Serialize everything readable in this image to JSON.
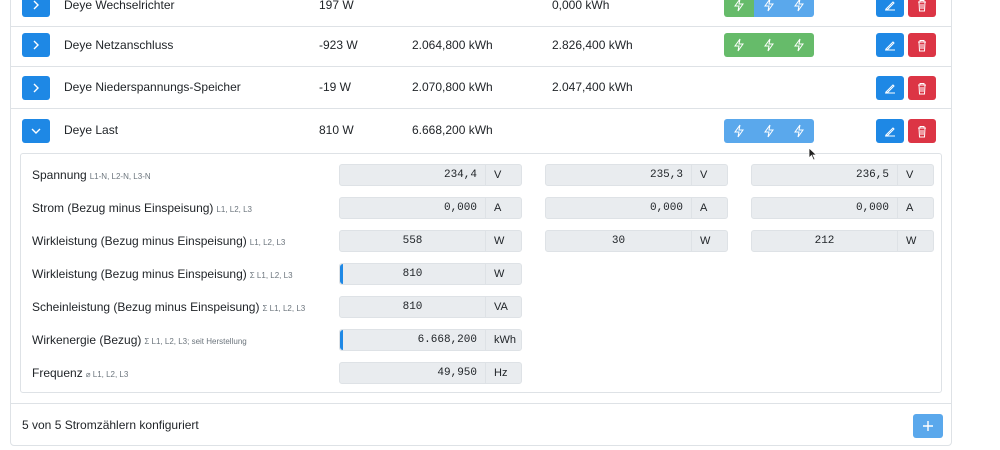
{
  "meters": [
    {
      "name": "Deye Wechselrichter",
      "power": "197 W",
      "energy_import": "",
      "energy_export": "0,000 kWh",
      "expanded": false,
      "toggle": "chevron-right"
    },
    {
      "name": "Deye Netzanschluss",
      "power": "-923 W",
      "energy_import": "2.064,800 kWh",
      "energy_export": "2.826,400 kWh",
      "expanded": false,
      "toggle": "chevron-right"
    },
    {
      "name": "Deye Niederspannungs-Speicher",
      "power": "-19 W",
      "energy_import": "2.070,800 kWh",
      "energy_export": "2.047,400 kWh",
      "expanded": false,
      "toggle": "chevron-right"
    },
    {
      "name": "Deye Last",
      "power": "810 W",
      "energy_import": "6.668,200 kWh",
      "energy_export": "",
      "expanded": true,
      "toggle": "chevron-down"
    }
  ],
  "details": {
    "spannung": {
      "label": "Spannung",
      "sub": "L1-N, L2-N, L3-N",
      "values": [
        "234,4",
        "235,3",
        "236,5"
      ],
      "unit": "V"
    },
    "strom": {
      "label": "Strom (Bezug minus Einspeisung)",
      "sub": "L1, L2, L3",
      "values": [
        "0,000",
        "0,000",
        "0,000"
      ],
      "unit": "A"
    },
    "wirkleistung": {
      "label": "Wirkleistung (Bezug minus Einspeisung)",
      "sub": "L1, L2, L3",
      "values": [
        "558",
        "30",
        "212"
      ],
      "unit": "W"
    },
    "wirkleistung_sum": {
      "label": "Wirkleistung (Bezug minus Einspeisung)",
      "sub": "Σ L1, L2, L3",
      "value": "810",
      "unit": "W"
    },
    "scheinleistung": {
      "label": "Scheinleistung (Bezug minus Einspeisung)",
      "sub": "Σ L1, L2, L3",
      "value": "810",
      "unit": "VA"
    },
    "wirkenergie": {
      "label": "Wirkenergie (Bezug)",
      "sub": "Σ L1, L2, L3; seit Herstellung",
      "value": "6.668,200",
      "unit": "kWh"
    },
    "frequenz": {
      "label": "Frequenz",
      "sub": "⌀ L1, L2, L3",
      "value": "49,950",
      "unit": "Hz"
    }
  },
  "footer": {
    "text": "5 von 5 Stromzählern konfiguriert"
  },
  "colors": {
    "primary": "#1e88e5",
    "danger": "#dc3545",
    "success": "#5cb85c",
    "info": "#5aa8ec"
  },
  "icons": {
    "edit": "pencil-icon",
    "delete": "trash-icon",
    "phase": "lightning-icon",
    "add": "plus-icon"
  }
}
